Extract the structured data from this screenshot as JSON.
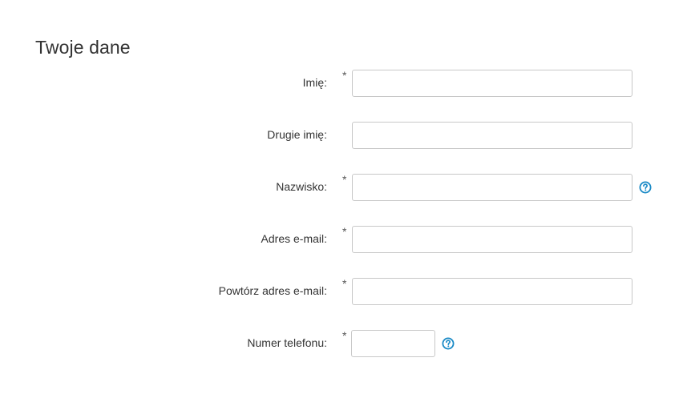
{
  "section": {
    "title": "Twoje dane"
  },
  "form": {
    "first_name": {
      "label": "Imię:",
      "required_mark": "*",
      "value": ""
    },
    "middle_name": {
      "label": "Drugie imię:",
      "value": ""
    },
    "last_name": {
      "label": "Nazwisko:",
      "required_mark": "*",
      "value": "",
      "help_icon": "question-circle-icon"
    },
    "email": {
      "label": "Adres e-mail:",
      "required_mark": "*",
      "value": ""
    },
    "email_repeat": {
      "label": "Powtórz adres e-mail:",
      "required_mark": "*",
      "value": ""
    },
    "phone": {
      "label": "Numer telefonu:",
      "required_mark": "*",
      "value": "",
      "help_icon": "question-circle-icon"
    }
  },
  "colors": {
    "accent": "#1a8ac6",
    "input_border": "#c8c8c8",
    "text": "#333333"
  }
}
